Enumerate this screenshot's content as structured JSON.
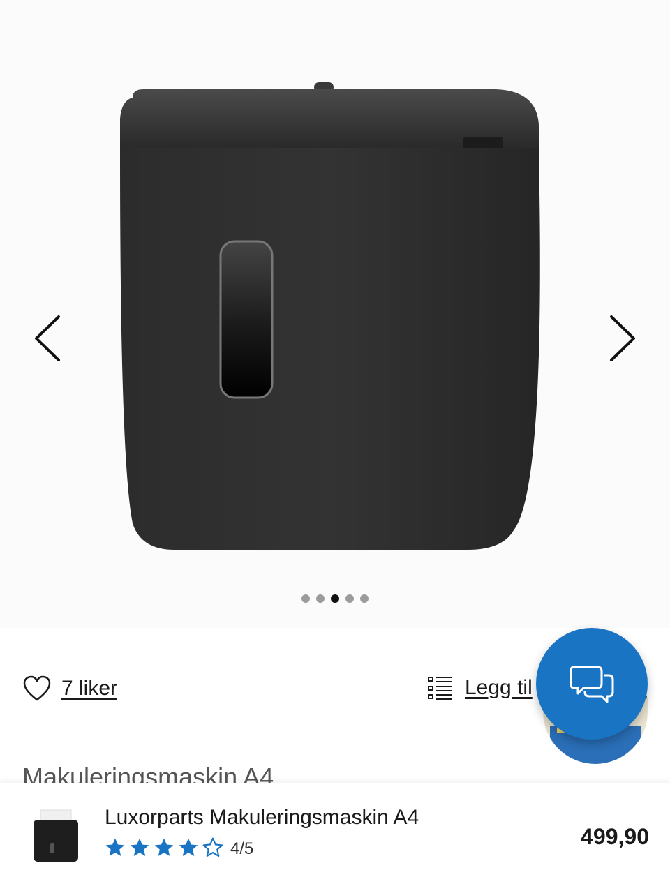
{
  "gallery": {
    "image_alt": "",
    "prev_icon": "chevron-left-icon",
    "next_icon": "chevron-right-icon",
    "dots_total": 5,
    "active_dot": 3
  },
  "actions": {
    "like_label": "7 liker",
    "list_label": "Legg til",
    "list_label_suffix": "l"
  },
  "product": {
    "title_partial": "Makuleringsmaskin A4"
  },
  "bottom_bar": {
    "title": "Luxorparts Makuleringsmaskin A4",
    "rating_text": "4/5",
    "rating_value": 4.5,
    "rating_max": 5,
    "price": "499,90"
  },
  "colors": {
    "accent": "#1a74c4",
    "star": "#1a74c4"
  }
}
